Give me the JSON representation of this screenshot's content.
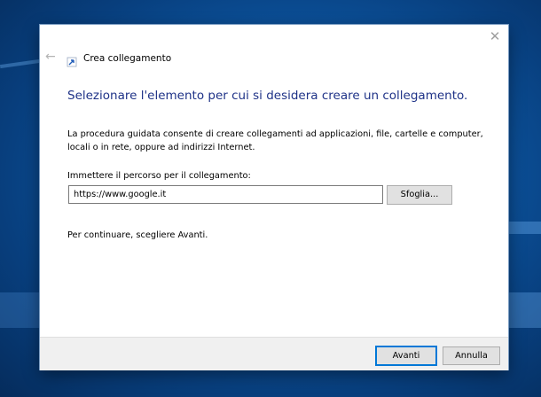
{
  "wizard": {
    "title": "Crea collegamento",
    "heading": "Selezionare l'elemento per cui si desidera creare un collegamento.",
    "description": "La procedura guidata consente di creare collegamenti ad applicazioni, file, cartelle e computer, locali o in rete, oppure ad indirizzi Internet.",
    "path_label": "Immettere il percorso per il collegamento:",
    "path_value": "https://www.google.it",
    "browse_label": "Sfoglia...",
    "hint": "Per continuare, scegliere Avanti."
  },
  "titlebar": {
    "close_symbol": "✕",
    "back_symbol": "←"
  },
  "footer": {
    "next_label": "Avanti",
    "cancel_label": "Annulla"
  },
  "colors": {
    "heading": "#1e3287",
    "accent": "#0078d7",
    "desktop": "#0d5aa8"
  },
  "icons": {
    "back": "back-arrow-icon",
    "close": "close-icon",
    "wizard": "shortcut-wizard-icon"
  }
}
